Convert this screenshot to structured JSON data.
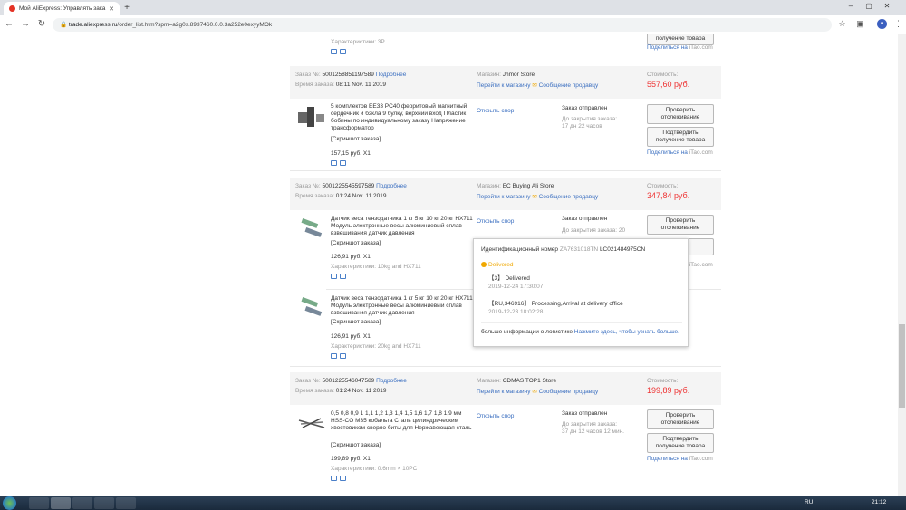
{
  "browser": {
    "tab_title": "Мой AliExpress: Управлять зака",
    "url_host": "trade.aliexpress.ru",
    "url_path": "/order_list.htm?spm=a2g0s.8937460.0.0.3a252e0exyyMOk"
  },
  "top_partial": {
    "characteristics": "Характеристики: 3P",
    "btn_confirm": "получение товара",
    "share_prefix": "Поделиться на",
    "share_site": "iTao.com"
  },
  "labels": {
    "order_no": "Заказ №:",
    "details": "Подробнее",
    "order_time": "Время заказа:",
    "shop": "Магазин:",
    "go_to_shop": "Перейти к магазину",
    "message_seller": "Сообщение продавцу",
    "cost": "Стоимость:",
    "open_dispute": "Открыть спор",
    "order_sent": "Заказ отправлен",
    "track": "Проверить отслеживание",
    "confirm": "Подтвердить получение товара",
    "share_prefix": "Поделиться на",
    "share_site": "iTao.com",
    "screenshot": "[Скриншот заказа]"
  },
  "orders": [
    {
      "number": "5001258851197589",
      "time": "08:11 Nov. 11 2019",
      "shop": "Jhmor Store",
      "cost": "557,60 руб.",
      "product": "5 комплектов EE33 PC40 ферритовый магнитный сердечник и бэкла 9 булку, верхний вход Пластик бобины по индивидуальному заказу Напряжение трансформатор",
      "price": "157,15 руб. X1",
      "countdown": "До закрытия заказа: 17 дн 22 часов"
    },
    {
      "number": "5001225545597589",
      "time": "01:24 Nov. 11 2019",
      "shop": "EC Buying Ali Store",
      "cost": "347,84 руб.",
      "product": "Датчик веса тензодатчика 1 кг 5 кг 10 кг 20 кг HX711 Модуль электронные весы алюминиевый сплав взвешивания датчик давления",
      "price": "126,91 руб. X1",
      "characteristics": "Характеристики: 10kg and HX711",
      "countdown": "До закрытия заказа: 20",
      "product2": "Датчик веса тензодатчика 1 кг 5 кг 10 кг 20 кг HX711 Модуль электронные весы алюминиевый сплав взвешивания датчик давления",
      "price2": "126,91 руб. X1",
      "characteristics2": "Характеристики: 20kg and HX711"
    },
    {
      "number": "5001225546047589",
      "time": "01:24 Nov. 11 2019",
      "shop": "CDMAS TOP1 Store",
      "cost": "199,89 руб.",
      "product": "0,5 0,8 0,9 1 1,1 1,2 1,3 1,4 1,5 1,6 1,7 1,8 1,9 мм HSS-CO M35 кобальта Сталь цилиндрическим хвостовиком сверло биты для Нержавеющая сталь",
      "price": "199,89 руб. X1",
      "characteristics": "Характеристики: 0.6mm × 10PC",
      "countdown": "До закрытия заказа: 37 дн 12 часов 12 мин."
    }
  ],
  "popup": {
    "id_label": "Идентификационный номер",
    "id_value": "ZA7631018TN",
    "id_tracking": "LC021484975CN",
    "status": "Delivered",
    "event1_code": "【3】",
    "event1_text": "Delivered",
    "event1_time": "2019-12-24 17:30:07",
    "event2_code": "【RU,346916】",
    "event2_text": "Processing,Arrival at delivery office",
    "event2_time": "2019-12-23 18:02:28",
    "more_text": "больше информации о логистике",
    "more_link": "Нажмите здесь, чтобы узнать больше."
  },
  "taskbar": {
    "lang": "RU",
    "time": "21:12"
  }
}
